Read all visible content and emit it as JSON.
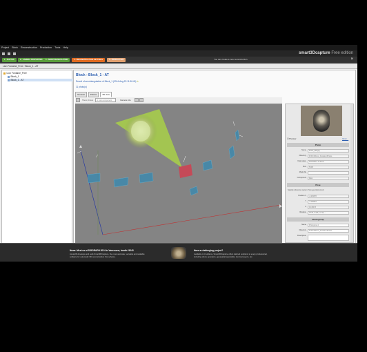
{
  "menu": [
    "Project",
    "Block",
    "Reconstruction",
    "Production",
    "Tools",
    "Help"
  ],
  "brand": {
    "name": "smart3Dcapture",
    "edition": "Free edition"
  },
  "steps": [
    {
      "label": "1 - PHOTOS",
      "color": "#5a9e3c"
    },
    {
      "label": "2 - CAMERA PROPERTIES",
      "color": "#5a9e3c"
    },
    {
      "label": "3 - AEROTRIANGULATION",
      "color": "#5a9e3c"
    },
    {
      "label": "4 - RECONSTRUCTION SETTINGS",
      "color": "#e06a20"
    },
    {
      "label": "5 - PRODUCTION",
      "color": "#e0a070"
    }
  ],
  "notice": "You can create a new reconstruction.",
  "breadcrumb": "Lion Fontaine_Free  ›  Block_1 - AT",
  "tree": [
    "Lion Fontaine_Free",
    "Block_1",
    "Block_1 - AT"
  ],
  "main": {
    "title": "Block - Block_1 - AT",
    "subtitle": "Result of aerotriangulation of Block_1 (2014-Aug-29 11:36:40)",
    "photos_count": "11 photo(s)",
    "tabs": [
      "General",
      "Photos",
      "3D view"
    ],
    "show_photos_label": "Show photos",
    "component_select": "In main component",
    "camera_size_label": "Camera size"
  },
  "panel": {
    "preview_label": "Preview",
    "open_link": "Open...",
    "sections": {
      "photo": "Photo",
      "pose": "Pose",
      "photogroup": "Photogroup"
    },
    "photo_fields": [
      {
        "label": "Name",
        "value": "Photo_008.jpg"
      },
      {
        "label": "Directory",
        "value": "D:\\Pix4D\\Lion_Fontaine\\Photos"
      },
      {
        "label": "Date taken",
        "value": "2014/05/14 11:25:47"
      },
      {
        "label": "Size",
        "value": "5 MB"
      },
      {
        "label": "Mask file",
        "value": ""
      },
      {
        "label": "Component",
        "value": "Main"
      }
    ],
    "pose_note": "Spatial reference system: Non-georeferenced",
    "pose_fields": [
      {
        "label": "Position X",
        "value": "-0.209578"
      },
      {
        "label": "Y",
        "value": "-0.195615"
      },
      {
        "label": "Z",
        "value": "0.133473"
      },
      {
        "label": "Rotation",
        "value": "0.578, 0.425, -0.713, ..."
      }
    ],
    "photogroup_fields": [
      {
        "label": "Name",
        "value": "Photogroup 1"
      },
      {
        "label": "Directory",
        "value": "D:\\Pix4D\\Lion_Fontaine\\Photos"
      },
      {
        "label": "Description",
        "value": ""
      }
    ]
  },
  "footer": {
    "news_title": "News: Meet us at SIGGRAPH 2014 in Vancouver, booth #1043",
    "news_text": [
      "Acute3D develops and sells Smart3DCapture, the most accurate, versatile and scalable",
      "software for automatic 3D reconstruction from photos."
    ],
    "promo_title": "Have a challenging project?",
    "promo_text": [
      "Available in 3 editions, Smart3DCapture offers tailored solutions to every professional,",
      "including drone operators, geospatial specialists, land surveyors, etc."
    ]
  }
}
